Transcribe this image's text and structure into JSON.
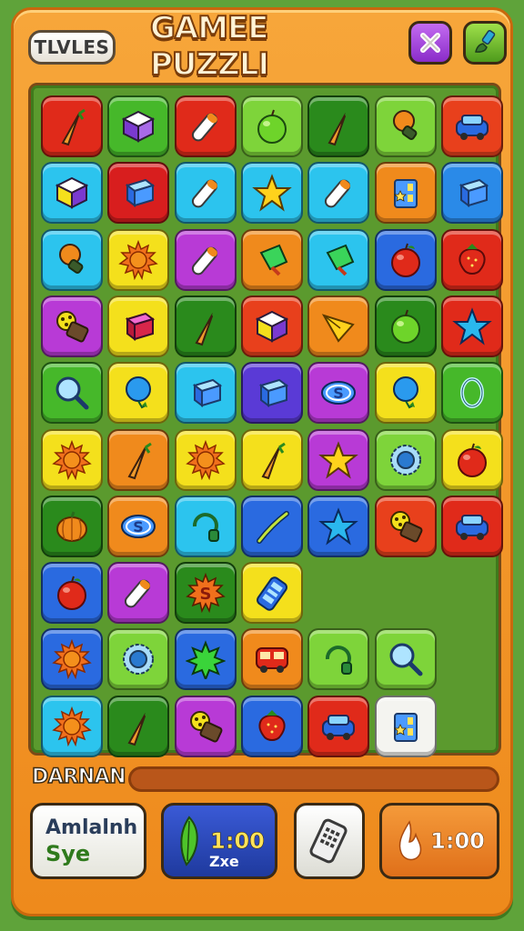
{
  "header": {
    "tiles_button": "TLVLES",
    "title": "GAMEE PUZZLI",
    "close_icon": "close-icon",
    "brush_icon": "brush-icon"
  },
  "board": {
    "rows": [
      [
        {
          "icon": "carrot",
          "color": "#e02a1a"
        },
        {
          "icon": "cube-purple",
          "color": "#46b82a"
        },
        {
          "icon": "tube",
          "color": "#e02a1a"
        },
        {
          "icon": "apple-green",
          "color": "#7ed43a"
        },
        {
          "icon": "carrot",
          "color": "#2a8a1c"
        },
        {
          "icon": "lollipop",
          "color": "#7ed43a"
        },
        {
          "icon": "car",
          "color": "#e8401c"
        }
      ],
      [
        {
          "icon": "cube-white",
          "color": "#2cc4ee"
        },
        {
          "icon": "box-blue",
          "color": "#d81e1e"
        },
        {
          "icon": "tube",
          "color": "#2cc4ee"
        },
        {
          "icon": "star-yellow",
          "color": "#2cc4ee"
        },
        {
          "icon": "tube",
          "color": "#2cc4ee"
        },
        {
          "icon": "box-blue-star",
          "color": "#f08a1c"
        },
        {
          "icon": "box-blue",
          "color": "#2a8ae8"
        }
      ],
      [
        {
          "icon": "lollipop",
          "color": "#2cc4ee"
        },
        {
          "icon": "sun",
          "color": "#f4e01c"
        },
        {
          "icon": "tube",
          "color": "#b83ad6"
        },
        {
          "icon": "gem-green",
          "color": "#f08a1c"
        },
        {
          "icon": "gem-green",
          "color": "#2cc4ee"
        },
        {
          "icon": "apple-red",
          "color": "#2a6ae0"
        },
        {
          "icon": "strawberry",
          "color": "#e02a1a"
        }
      ],
      [
        {
          "icon": "cookie",
          "color": "#b83ad6"
        },
        {
          "icon": "box-red",
          "color": "#f4e01c"
        },
        {
          "icon": "carrot",
          "color": "#2a8a1c"
        },
        {
          "icon": "cube-white",
          "color": "#e8401c"
        },
        {
          "icon": "kite",
          "color": "#f08a1c"
        },
        {
          "icon": "apple-green",
          "color": "#2a8a1c"
        },
        {
          "icon": "star-blue",
          "color": "#e02a1a"
        }
      ],
      [
        {
          "icon": "magnifier",
          "color": "#46b82a"
        },
        {
          "icon": "balloon",
          "color": "#f4e01c"
        },
        {
          "icon": "box-blue",
          "color": "#2cc4ee"
        },
        {
          "icon": "box-blue",
          "color": "#5a3ad6"
        },
        {
          "icon": "coin-s",
          "color": "#b83ad6"
        },
        {
          "icon": "balloon",
          "color": "#f4e01c"
        },
        {
          "icon": "ring",
          "color": "#46b82a"
        }
      ],
      [
        {
          "icon": "sun",
          "color": "#f4e01c"
        },
        {
          "icon": "carrot",
          "color": "#f08a1c"
        },
        {
          "icon": "sun",
          "color": "#f4e01c"
        },
        {
          "icon": "carrot",
          "color": "#f4e01c"
        },
        {
          "icon": "star-yellow",
          "color": "#b83ad6"
        },
        {
          "icon": "gear",
          "color": "#7ed43a"
        },
        {
          "icon": "apple-red",
          "color": "#f4e01c"
        }
      ],
      [
        {
          "icon": "pumpkin",
          "color": "#2a8a1c"
        },
        {
          "icon": "coin-s",
          "color": "#f08a1c"
        },
        {
          "icon": "hook",
          "color": "#2cc4ee"
        },
        {
          "icon": "stick",
          "color": "#2a6ae0"
        },
        {
          "icon": "star-blue",
          "color": "#2a6ae0"
        },
        {
          "icon": "cookie",
          "color": "#e8401c"
        },
        {
          "icon": "car",
          "color": "#e02a1a"
        }
      ],
      [
        {
          "icon": "apple-red",
          "color": "#2a6ae0"
        },
        {
          "icon": "tube",
          "color": "#b83ad6"
        },
        {
          "icon": "sun-s",
          "color": "#2a8a1c"
        },
        {
          "icon": "phone",
          "color": "#f4e01c"
        }
      ],
      [
        {
          "icon": "sun",
          "color": "#2a6ae0"
        },
        {
          "icon": "gear",
          "color": "#7ed43a"
        },
        {
          "icon": "star-green",
          "color": "#2a6ae0"
        },
        {
          "icon": "bus",
          "color": "#f08a1c"
        },
        {
          "icon": "hook",
          "color": "#7ed43a"
        },
        {
          "icon": "magnifier",
          "color": "#7ed43a"
        }
      ],
      [
        {
          "icon": "sun",
          "color": "#2cc4ee"
        },
        {
          "icon": "carrot",
          "color": "#2a8a1c"
        },
        {
          "icon": "cookie",
          "color": "#b83ad6"
        },
        {
          "icon": "strawberry",
          "color": "#2a6ae0"
        },
        {
          "icon": "car",
          "color": "#e02a1a"
        },
        {
          "icon": "box-blue-star",
          "color": "#f4f4f0"
        }
      ]
    ]
  },
  "status": {
    "label": "DARNAN",
    "progress": 0.0
  },
  "controls": {
    "mode_line1": "Amlalnh",
    "mode_line2": "Sye",
    "timer_value": "1:00",
    "timer_sub": "Zxe",
    "tool_icon": "phone-icon",
    "time2_value": "1:00"
  }
}
